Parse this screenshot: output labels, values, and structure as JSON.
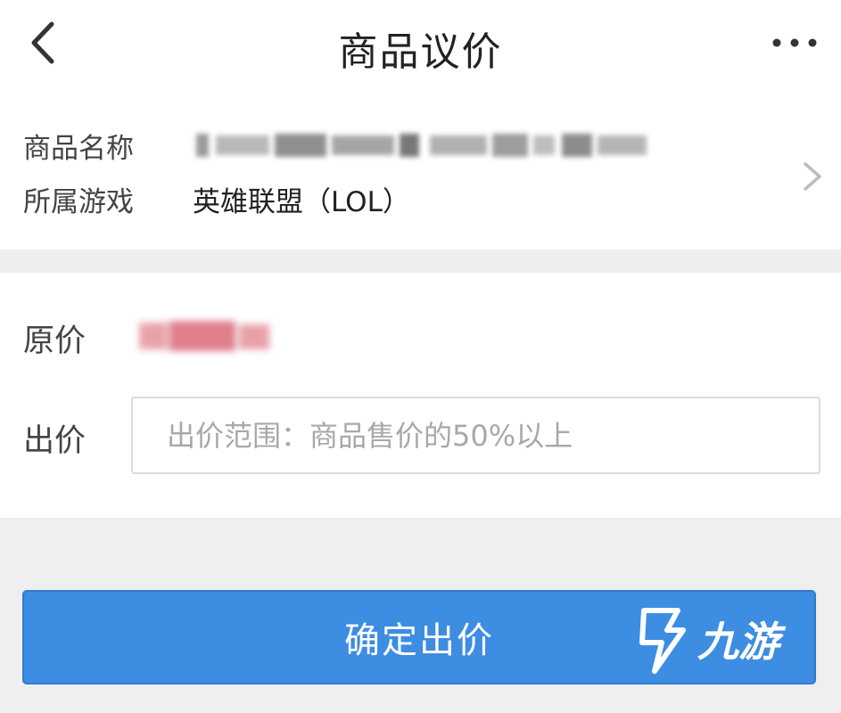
{
  "header": {
    "title": "商品议价",
    "back_icon": "chevron-left-icon",
    "more_icon": "more-horizontal-icon"
  },
  "product_info": {
    "name_label": "商品名称",
    "game_label": "所属游戏",
    "game_value": "英雄联盟（LOL）",
    "arrow_icon": "chevron-right-icon"
  },
  "pricing": {
    "original_price_label": "原价",
    "bid_label": "出价",
    "bid_placeholder": "出价范围：商品售价的50%以上",
    "bid_value": ""
  },
  "actions": {
    "confirm_label": "确定出价"
  },
  "watermark": {
    "text": "九游",
    "icon": "jiuyou-logo-icon"
  },
  "colors": {
    "primary": "#3d8de3",
    "background": "#efefef",
    "card": "#ffffff",
    "price_blur": "#e38a94"
  }
}
